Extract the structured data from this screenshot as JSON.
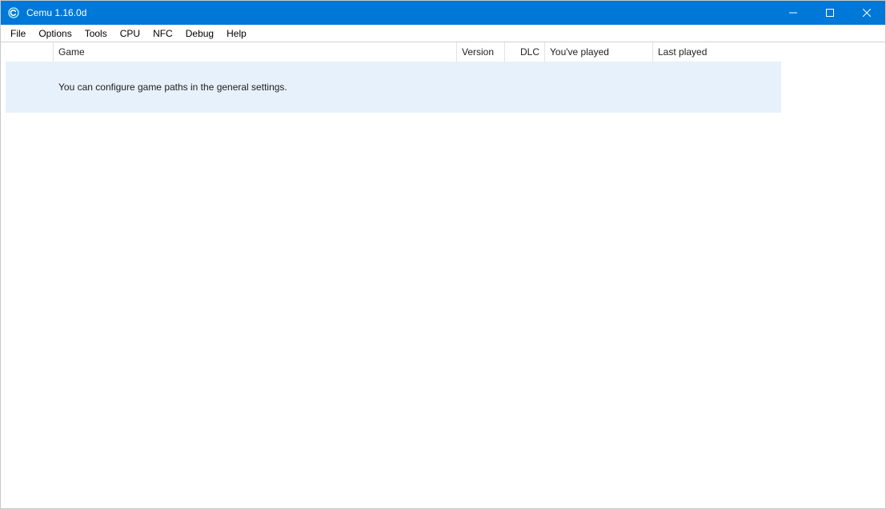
{
  "titlebar": {
    "title": "Cemu 1.16.0d"
  },
  "menu": {
    "items": [
      "File",
      "Options",
      "Tools",
      "CPU",
      "NFC",
      "Debug",
      "Help"
    ]
  },
  "table": {
    "headers": {
      "icon": "",
      "game": "Game",
      "version": "Version",
      "dlc": "DLC",
      "played": "You've played",
      "last": "Last played"
    },
    "info_row": {
      "message": "You can configure game paths in the general settings."
    }
  }
}
